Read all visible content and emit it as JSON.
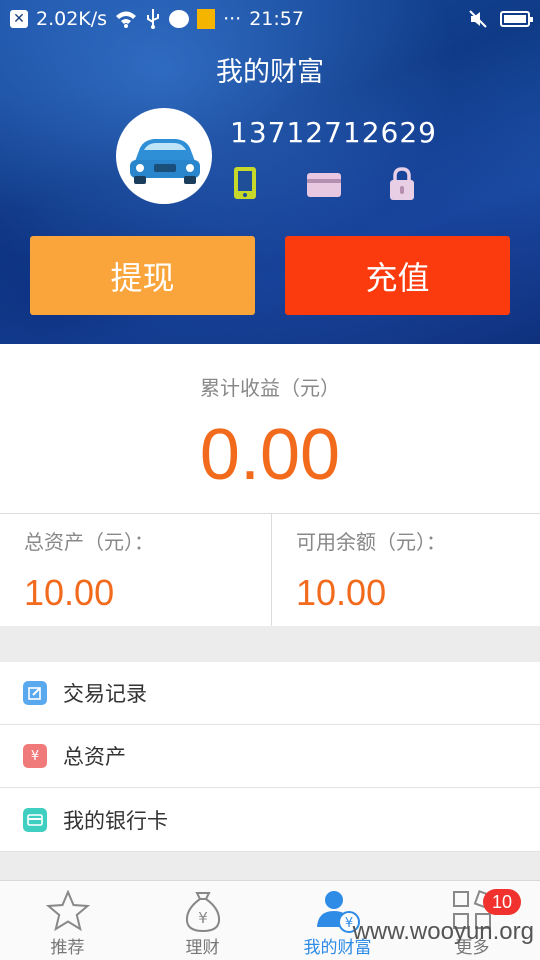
{
  "status_bar": {
    "speed": "2.02K/s",
    "time": "21:57",
    "dots": "···"
  },
  "header": {
    "title": "我的财富",
    "phone": "13712712629",
    "withdraw_label": "提现",
    "recharge_label": "充值",
    "avatar_icon": "car-icon",
    "status_icons": [
      "phone-icon",
      "card-icon",
      "lock-icon"
    ]
  },
  "earnings": {
    "label": "累计收益（元）",
    "value": "0.00"
  },
  "balances": {
    "total_label": "总资产（元）：",
    "total_value": "10.00",
    "available_label": "可用余额（元）：",
    "available_value": "10.00"
  },
  "menu": {
    "items": [
      {
        "label": "交易记录",
        "icon": "edit-icon",
        "color": "#5aa9ef"
      },
      {
        "label": "总资产",
        "icon": "yen-icon",
        "color": "#f0797a"
      },
      {
        "label": "我的银行卡",
        "icon": "card-icon",
        "color": "#3fcfc0"
      }
    ]
  },
  "tabbar": {
    "tabs": [
      {
        "label": "推荐",
        "icon": "star-icon"
      },
      {
        "label": "理财",
        "icon": "money-bag-icon"
      },
      {
        "label": "我的财富",
        "icon": "user-yen-icon"
      },
      {
        "label": "更多",
        "icon": "grid-icon"
      }
    ],
    "more_badge": "10"
  },
  "watermark": "www.wooyun.org",
  "colors": {
    "accent_orange": "#f26a1c",
    "withdraw": "#f9a53b",
    "recharge": "#fb3a0e",
    "active_tab": "#2e8be6"
  }
}
